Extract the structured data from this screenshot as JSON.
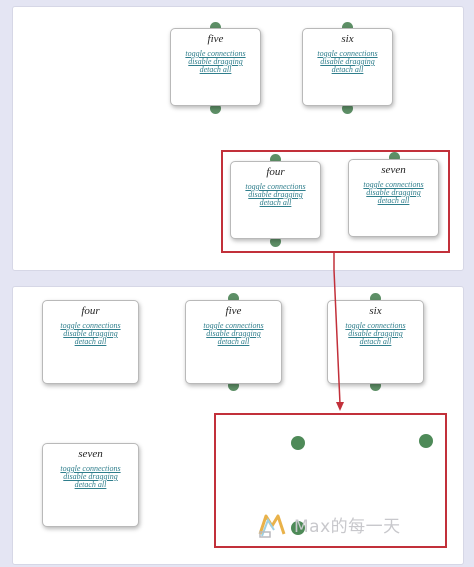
{
  "colors": {
    "accent_highlight": "#c2303a",
    "endpoint": "#5d8f66",
    "link": "#2f7e8c",
    "background": "#e4e5f3"
  },
  "top_panel": {
    "cards": [
      {
        "title": "five",
        "links": [
          "toggle connections",
          "disable dragging",
          "detach all"
        ]
      },
      {
        "title": "six",
        "links": [
          "toggle connections",
          "disable dragging",
          "detach all"
        ]
      },
      {
        "title": "four",
        "links": [
          "toggle connections",
          "disable dragging",
          "detach all"
        ]
      },
      {
        "title": "seven",
        "links": [
          "toggle connections",
          "disable dragging",
          "detach all"
        ]
      }
    ]
  },
  "bottom_panel": {
    "cards": [
      {
        "title": "four",
        "links": [
          "toggle connections",
          "disable dragging",
          "detach all"
        ]
      },
      {
        "title": "five",
        "links": [
          "toggle connections",
          "disable dragging",
          "detach all"
        ]
      },
      {
        "title": "six",
        "links": [
          "toggle connections",
          "disable dragging",
          "detach all"
        ]
      },
      {
        "title": "seven",
        "links": [
          "toggle connections",
          "disable dragging",
          "detach all"
        ]
      }
    ]
  },
  "watermark": {
    "text": "Max的每一天"
  }
}
